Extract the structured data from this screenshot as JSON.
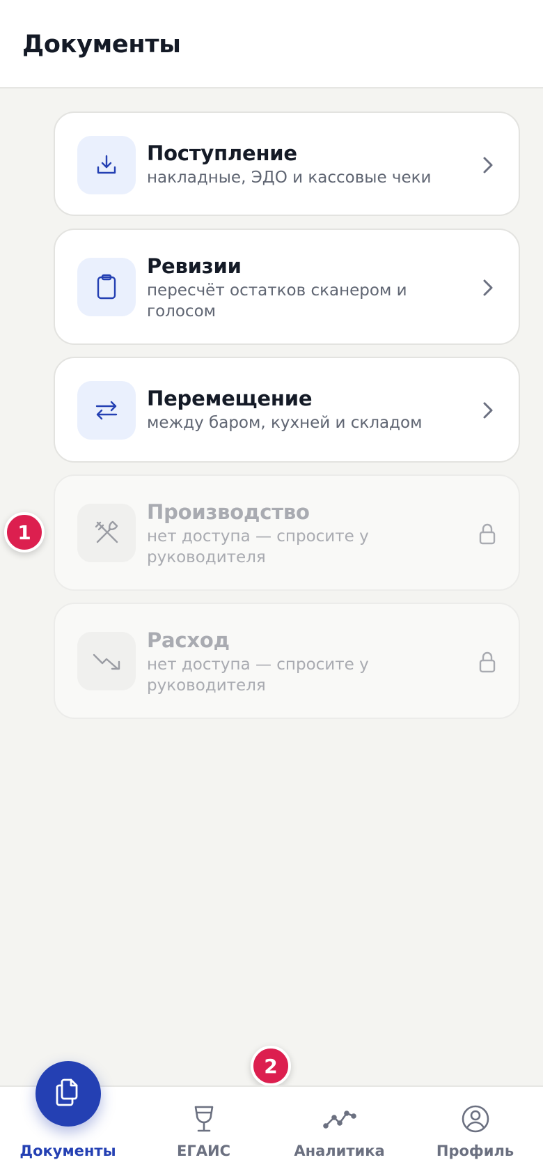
{
  "header": {
    "title": "Документы"
  },
  "cards": [
    {
      "title": "Поступление",
      "subtitle": "накладные, ЭДО и кассовые чеки",
      "icon": "download-icon",
      "locked": false
    },
    {
      "title": "Ревизии",
      "subtitle": "пересчёт остатков сканером и голосом",
      "icon": "clipboard-icon",
      "locked": false
    },
    {
      "title": "Перемещение",
      "subtitle": "между баром, кухней и складом",
      "icon": "transfer-arrows-icon",
      "locked": false
    },
    {
      "title": "Производство",
      "subtitle": "нет доступа — спросите у руководителя",
      "icon": "utensils-icon",
      "locked": true
    },
    {
      "title": "Расход",
      "subtitle": "нет доступа — спросите у руководителя",
      "icon": "trending-down-icon",
      "locked": true
    }
  ],
  "badges": {
    "first": "1",
    "second": "2"
  },
  "tabbar": {
    "items": [
      {
        "label": "Документы",
        "icon": "documents-icon",
        "active": true
      },
      {
        "label": "ЕГАИС",
        "icon": "wine-glass-icon",
        "active": false
      },
      {
        "label": "Аналитика",
        "icon": "analytics-line-icon",
        "active": false
      },
      {
        "label": "Профиль",
        "icon": "profile-icon",
        "active": false
      }
    ]
  },
  "colors": {
    "accent": "#2440b3",
    "badge": "#dc1f4f",
    "background": "#f4f4f1"
  }
}
